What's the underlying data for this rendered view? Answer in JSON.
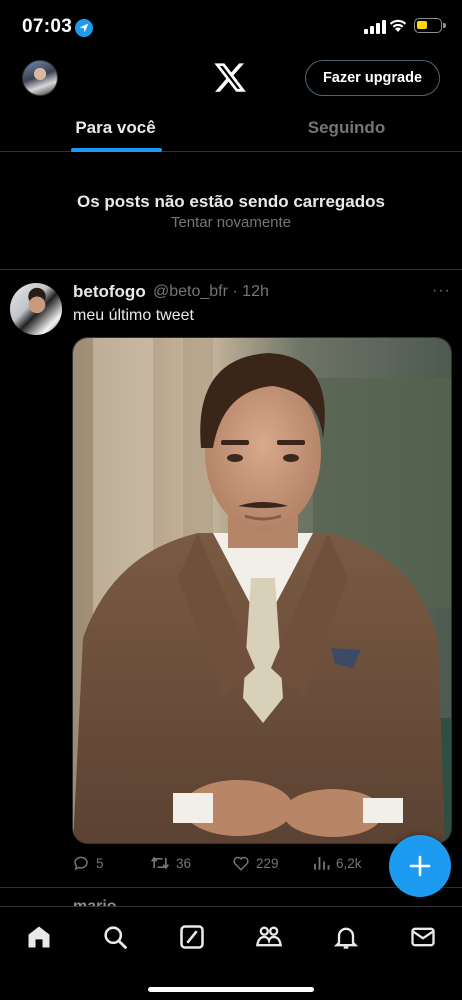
{
  "status_bar": {
    "time": "07:03",
    "icons": [
      "location-arrow-icon",
      "cellular-signal-icon",
      "wifi-icon",
      "battery-icon"
    ],
    "battery_color": "#ffd60a",
    "battery_level": 0.45
  },
  "header": {
    "logo": "x-logo-icon",
    "upgrade_label": "Fazer upgrade"
  },
  "tabs": [
    {
      "label": "Para você",
      "active": true
    },
    {
      "label": "Seguindo",
      "active": false
    }
  ],
  "error": {
    "title": "Os posts não estão sendo carregados",
    "retry_label": "Tentar novamente"
  },
  "tweet": {
    "author": "betofogo",
    "handle_time": "@beto_bfr · 12h",
    "more": "···",
    "text": "meu último tweet",
    "actions": {
      "replies": "5",
      "retweets": "36",
      "likes": "229",
      "views": "6,2k"
    }
  },
  "next_tweet_peek": "mario",
  "nav": [
    "home-icon",
    "search-icon",
    "grok-icon",
    "communities-icon",
    "notifications-icon",
    "messages-icon"
  ],
  "colors": {
    "accent": "#1d9bf0",
    "background": "#000000",
    "text_primary": "#e7e9ea",
    "text_secondary": "#71767b",
    "divider": "#2f3336"
  }
}
